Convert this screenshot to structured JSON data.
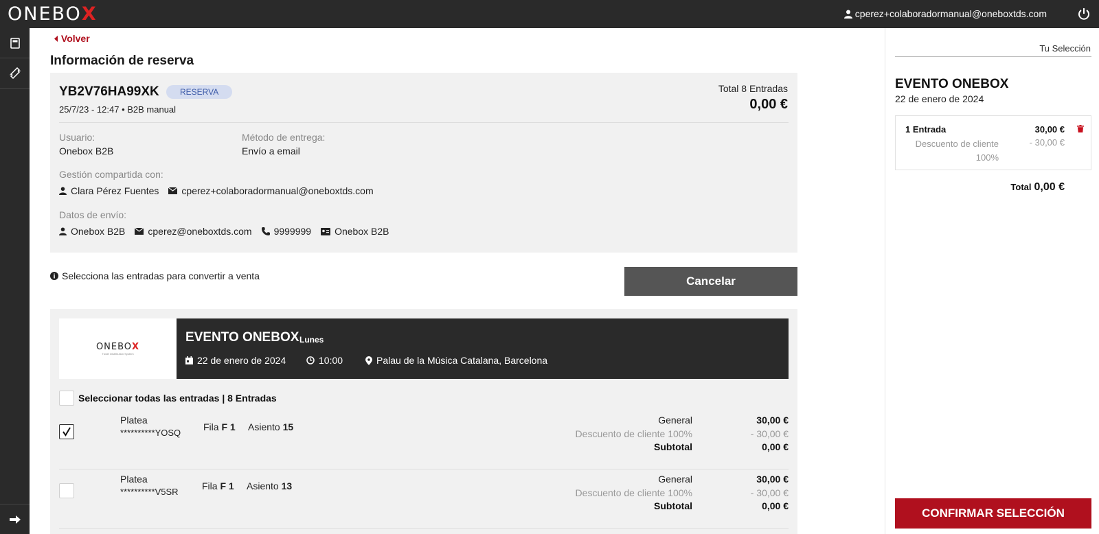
{
  "header": {
    "logo_main": "ONEBO",
    "logo_x": "X",
    "user_email": "cperez+colaboradormanual@oneboxtds.com"
  },
  "main": {
    "back_label": "Volver",
    "title": "Información de reserva",
    "reservation": {
      "code": "YB2V76HA99XK",
      "status": "RESERVA",
      "meta": "25/7/23 - 12:47  •  B2B manual",
      "total_label": "Total 8 Entradas",
      "total_value": "0,00 €",
      "user_label": "Usuario:",
      "user_value": "Onebox B2B",
      "delivery_label": "Método de entrega:",
      "delivery_value": "Envío a email",
      "shared_label": "Gestión compartida con:",
      "shared_name": "Clara Pérez Fuentes",
      "shared_email": "cperez+colaboradormanual@oneboxtds.com",
      "shipping_label": "Datos de envío:",
      "shipping_name": "Onebox B2B",
      "shipping_email": "cperez@oneboxtds.com",
      "shipping_phone": "9999999",
      "shipping_id": "Onebox B2B"
    },
    "info_text": "Selecciona las entradas para convertir a venta",
    "cancel_label": "Cancelar",
    "event": {
      "logo_main": "ONEBO",
      "logo_x": "X",
      "logo_sub": "Ticket Distribution System",
      "title": "EVENTO ONEBOX",
      "day": "Lunes",
      "date": "22 de enero de 2024",
      "time": "10:00",
      "venue": "Palau de la Música Catalana, Barcelona",
      "select_all": "Seleccionar todas las entradas | 8 Entradas"
    },
    "tickets": [
      {
        "checked": true,
        "zone": "Platea",
        "code": "**********YOSQ",
        "row_label": "Fila",
        "row": "F 1",
        "seat_label": "Asiento",
        "seat": "15",
        "price_label": "General",
        "price": "30,00 €",
        "discount_label": "Descuento de cliente 100%",
        "discount": "- 30,00 €",
        "subtotal_label": "Subtotal",
        "subtotal": "0,00 €"
      },
      {
        "checked": false,
        "zone": "Platea",
        "code": "**********V5SR",
        "row_label": "Fila",
        "row": "F 1",
        "seat_label": "Asiento",
        "seat": "13",
        "price_label": "General",
        "price": "30,00 €",
        "discount_label": "Descuento de cliente 100%",
        "discount": "- 30,00 €",
        "subtotal_label": "Subtotal",
        "subtotal": "0,00 €"
      }
    ]
  },
  "selection": {
    "heading": "Tu Selección",
    "event_title": "EVENTO ONEBOX",
    "event_date": "22 de enero de 2024",
    "item_label": "1 Entrada",
    "item_price": "30,00 €",
    "item_discount_label": "Descuento de cliente 100%",
    "item_discount": "- 30,00 €",
    "total_label": "Total",
    "total_value": "0,00 €",
    "confirm_label": "CONFIRMAR SELECCIÓN"
  },
  "colors": {
    "brand_red": "#b0101e",
    "dark": "#2a2a2a",
    "badge_bg": "#d4dcf0"
  }
}
